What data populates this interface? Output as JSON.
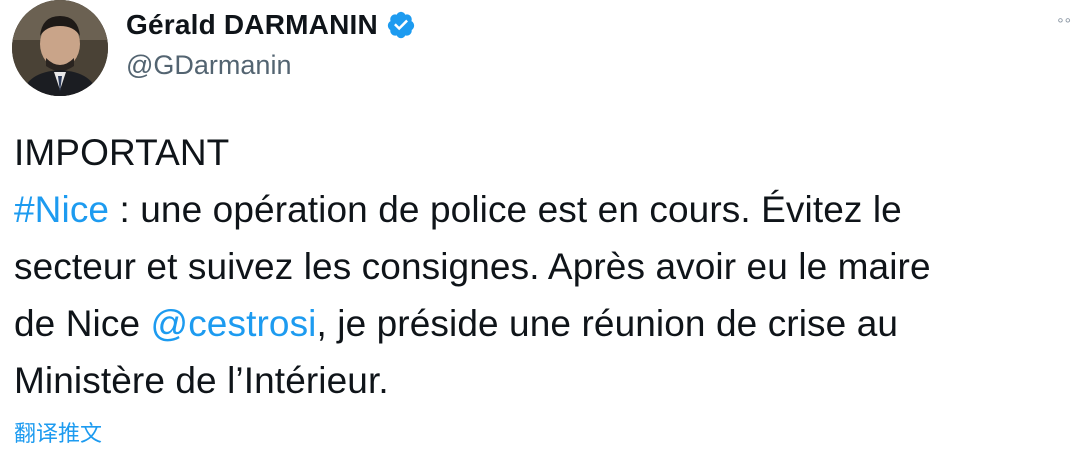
{
  "author": {
    "display_name": "Gérald DARMANIN",
    "handle": "@GDarmanin",
    "verified": true,
    "avatar_icon": "profile-photo"
  },
  "menu": {
    "icon": "more-horizontal-icon",
    "glyph": "°°"
  },
  "tweet": {
    "line1": "IMPORTANT",
    "hashtag": "#Nice",
    "line2_rest": " : une opération de police est en cours. Évitez le",
    "line3": "secteur et suivez les consignes. Après avoir eu le maire",
    "line4_start": "de Nice ",
    "mention": "@cestrosi",
    "line4_rest": ", je préside une réunion de crise au",
    "line5": "Ministère de l’Intérieur."
  },
  "translate_label": "翻译推文",
  "colors": {
    "link": "#1d9bf0",
    "verified": "#1d9bf0",
    "text": "#0f1419",
    "secondary": "#536471"
  }
}
